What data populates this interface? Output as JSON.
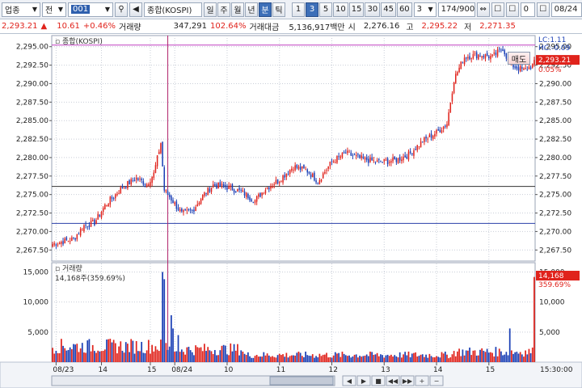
{
  "toolbar": {
    "category": "업종",
    "type": "전",
    "code": "001",
    "name": "종합(KOSPI)",
    "periods": [
      "일",
      "주",
      "월",
      "년",
      "분",
      "틱"
    ],
    "active_period": "분",
    "intervals": [
      "1",
      "3",
      "5",
      "10",
      "15",
      "30",
      "45",
      "60"
    ],
    "active_interval": "3",
    "interval_select": "3",
    "count": "174/900",
    "zero": "0",
    "date": "08/24"
  },
  "info": {
    "price": "2,293.21",
    "arrow": "▲",
    "change": "10.61",
    "change_pct": "+0.46%",
    "volume_label": "거래량",
    "volume": "347,291",
    "volume_pct": "102.64%",
    "amount_label": "거래대금",
    "amount": "5,136,917백만",
    "open_label": "시",
    "open": "2,276.16",
    "high_label": "고",
    "high": "2,295.22",
    "low_label": "저",
    "low": "2,271.35"
  },
  "side": {
    "buy_label": "매수",
    "sell_label": "매도"
  },
  "chart_data": {
    "type": "candlestick",
    "price_panel": {
      "title": "종합(KOSPI)",
      "ylim": [
        2266.0,
        2296.5
      ],
      "yticks": [
        "2,295.00",
        "2,292.50",
        "2,290.00",
        "2,287.50",
        "2,285.00",
        "2,282.50",
        "2,280.00",
        "2,277.50",
        "2,275.00",
        "2,272.50",
        "2,270.00",
        "2,267.50"
      ],
      "ytick_values": [
        2295.0,
        2292.5,
        2290.0,
        2287.5,
        2285.0,
        2282.5,
        2280.0,
        2277.5,
        2275.0,
        2272.5,
        2270.0,
        2267.5
      ],
      "lc_label": "LC:1.11",
      "hc_label": "HC:-0.09",
      "last_price_label": "2,293.21",
      "last_pct_label": "0.05%",
      "last_price": 2293.21,
      "hlines": [
        {
          "value": 2295.22,
          "color": "#c040c0"
        },
        {
          "value": 2276.1,
          "color": "#333333"
        },
        {
          "value": 2271.1,
          "color": "#2a3fa8"
        }
      ],
      "anchors": [
        [
          0,
          2268.3
        ],
        [
          12,
          2269.0
        ],
        [
          18,
          2270.8
        ],
        [
          24,
          2271.2
        ],
        [
          30,
          2273.5
        ],
        [
          40,
          2276.0
        ],
        [
          48,
          2277.2
        ],
        [
          54,
          2276.4
        ],
        [
          58,
          2277.8
        ],
        [
          62,
          2282.0
        ],
        [
          64,
          2275.6
        ],
        [
          68,
          2274.4
        ],
        [
          74,
          2272.4
        ],
        [
          80,
          2272.8
        ],
        [
          86,
          2274.8
        ],
        [
          92,
          2276.3
        ],
        [
          100,
          2276.0
        ],
        [
          108,
          2275.4
        ],
        [
          116,
          2274.2
        ],
        [
          122,
          2275.8
        ],
        [
          130,
          2277.0
        ],
        [
          138,
          2278.8
        ],
        [
          146,
          2278.2
        ],
        [
          152,
          2276.8
        ],
        [
          160,
          2279.4
        ],
        [
          168,
          2280.6
        ],
        [
          176,
          2279.9
        ],
        [
          186,
          2279.4
        ],
        [
          196,
          2279.6
        ],
        [
          204,
          2280.4
        ],
        [
          212,
          2282.2
        ],
        [
          220,
          2283.4
        ],
        [
          226,
          2284.6
        ],
        [
          230,
          2290.6
        ],
        [
          236,
          2293.6
        ],
        [
          244,
          2293.9
        ],
        [
          252,
          2293.6
        ],
        [
          258,
          2294.8
        ],
        [
          262,
          2292.6
        ],
        [
          270,
          2291.8
        ],
        [
          276,
          2292.6
        ]
      ]
    },
    "volume_panel": {
      "title": "거래량",
      "ylim": [
        0,
        16000
      ],
      "yticks": [
        "15,000",
        "10,000",
        "5,000"
      ],
      "ytick_values": [
        15000,
        10000,
        5000
      ],
      "last_label": "14,168주(359.69%)",
      "last_value_label": "14,168",
      "last_pct_label": "359.69%",
      "last_value": 14168,
      "spikes": [
        [
          63,
          15000
        ],
        [
          64,
          13800
        ],
        [
          68,
          7800
        ],
        [
          69,
          5600
        ],
        [
          72,
          4500
        ],
        [
          262,
          5600
        ],
        [
          276,
          14168
        ]
      ],
      "base": 2800
    },
    "x_labels": [
      {
        "index": 2,
        "label": "08/23"
      },
      {
        "index": 28,
        "label": "14"
      },
      {
        "index": 56,
        "label": "15"
      },
      {
        "index": 70,
        "label": "08/24"
      },
      {
        "index": 100,
        "label": "10"
      },
      {
        "index": 130,
        "label": "11"
      },
      {
        "index": 160,
        "label": "12"
      },
      {
        "index": 190,
        "label": "13"
      },
      {
        "index": 220,
        "label": "14"
      },
      {
        "index": 250,
        "label": "15"
      }
    ],
    "day_separator_index": 66,
    "n_bars": 277,
    "time_label": "15:30:00"
  }
}
